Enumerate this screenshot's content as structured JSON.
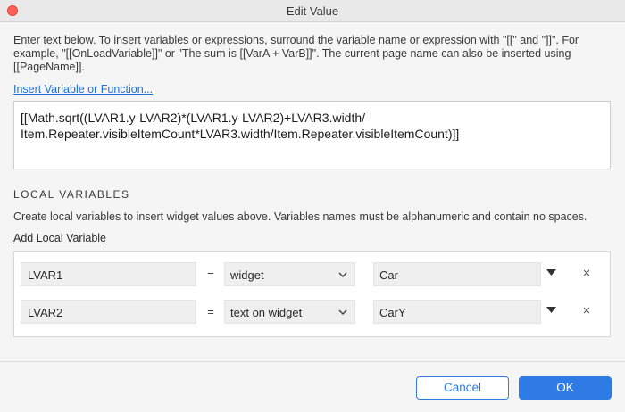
{
  "window": {
    "title": "Edit Value"
  },
  "intro": "Enter text below. To insert variables or expressions, surround the variable name or expression with \"[[\" and \"]]\". For example, \"[[OnLoadVariable]]\" or \"The sum is [[VarA + VarB]]\". The current page name can also be inserted using [[PageName]].",
  "insert_link": "Insert Variable or Function...",
  "expression": "[[Math.sqrt((LVAR1.y-LVAR2)*(LVAR1.y-LVAR2)+LVAR3.width/\nItem.Repeater.visibleItemCount*LVAR3.width/Item.Repeater.visibleItemCount)]]",
  "local": {
    "heading": "LOCAL VARIABLES",
    "description": "Create local variables to insert widget values above. Variables names must be alphanumeric and contain no spaces.",
    "add_link": "Add Local Variable",
    "equals": "=",
    "remove_symbol": "×",
    "rows": [
      {
        "name": "LVAR1",
        "type": "widget",
        "target": "Car"
      },
      {
        "name": "LVAR2",
        "type": "text on widget",
        "target": "CarY"
      }
    ]
  },
  "buttons": {
    "cancel": "Cancel",
    "ok": "OK"
  },
  "colors": {
    "accent": "#2f7be5",
    "close": "#fe5f57",
    "link": "#1f6fd8"
  }
}
